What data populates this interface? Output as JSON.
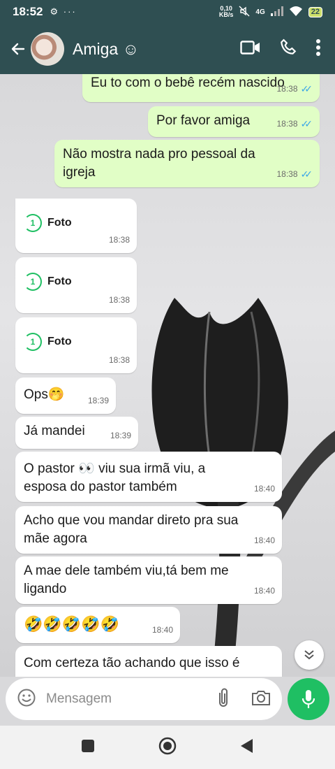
{
  "status": {
    "time": "18:52",
    "icons_left": "⚙ ···",
    "speed_top": "0,10",
    "speed_bottom": "KB/s",
    "network": "4G",
    "battery": "22"
  },
  "header": {
    "contact_name": "Amiga ☺"
  },
  "messages": [
    {
      "dir": "out",
      "text": "Eu to com o bebê recém nascido",
      "time": "18:38"
    },
    {
      "dir": "out",
      "text": "Por favor amiga",
      "time": "18:38"
    },
    {
      "dir": "out",
      "text": "Não mostra nada pro pessoal da igreja",
      "time": "18:38"
    },
    {
      "dir": "in",
      "type": "photo",
      "text": "Foto",
      "once_icon": "1",
      "time": "18:38"
    },
    {
      "dir": "in",
      "type": "photo",
      "text": "Foto",
      "once_icon": "1",
      "time": "18:38"
    },
    {
      "dir": "in",
      "type": "photo",
      "text": "Foto",
      "once_icon": "1",
      "time": "18:38"
    },
    {
      "dir": "in",
      "text": "Ops🤭",
      "time": "18:39"
    },
    {
      "dir": "in",
      "text": "Já mandei",
      "time": "18:39"
    },
    {
      "dir": "in",
      "text": "O pastor 👀 viu sua irmã viu, a esposa do pastor também",
      "time": "18:40"
    },
    {
      "dir": "in",
      "text": "Acho que vou mandar direto pra sua mãe agora",
      "time": "18:40"
    },
    {
      "dir": "in",
      "text": "A mae dele também viu,tá bem me ligando",
      "time": "18:40"
    },
    {
      "dir": "in",
      "text": "🤣🤣🤣🤣🤣",
      "time": "18:40"
    },
    {
      "dir": "in",
      "text": "Com certeza tão achando que isso é",
      "time": ""
    }
  ],
  "composer": {
    "placeholder": "Mensagem"
  },
  "colors": {
    "header": "#2f4f52",
    "outgoing": "#e1fec6",
    "incoming": "#ffffff",
    "accent": "#1fbf63",
    "read_ticks": "#3aa6e8"
  }
}
